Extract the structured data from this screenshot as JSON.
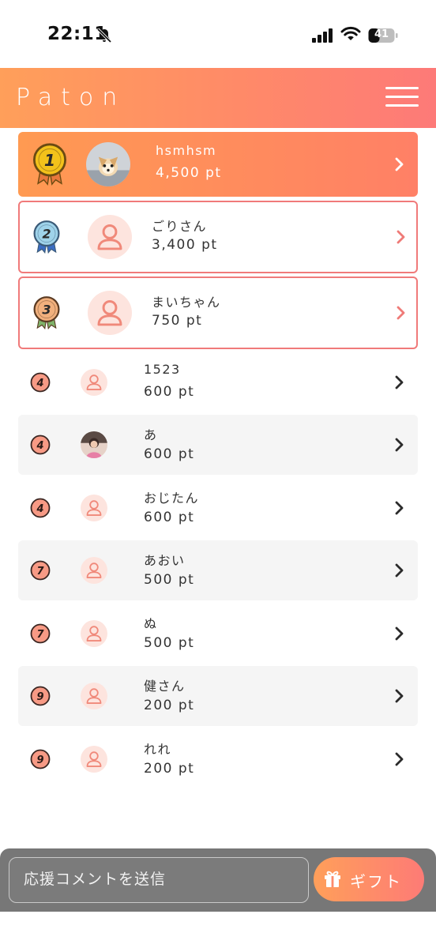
{
  "status_bar": {
    "time": "22:11",
    "battery": "41",
    "icons": [
      "bell-off-icon",
      "signal-icon",
      "wifi-icon",
      "battery-icon"
    ]
  },
  "header": {
    "logo": "Paton",
    "menu_icon": "hamburger-icon"
  },
  "ranking": [
    {
      "rank": "1",
      "name": "hsmhsm",
      "points": "4,500 pt",
      "avatar": "photo-dog"
    },
    {
      "rank": "2",
      "name": "ごりさん",
      "points": "3,400 pt",
      "avatar": "default-user"
    },
    {
      "rank": "3",
      "name": "まいちゃん",
      "points": "750 pt",
      "avatar": "default-user"
    },
    {
      "rank": "4",
      "name": "1523",
      "points": "600 pt",
      "avatar": "default-user"
    },
    {
      "rank": "4",
      "name": "あ",
      "points": "600 pt",
      "avatar": "photo-person"
    },
    {
      "rank": "4",
      "name": "おじたん",
      "points": "600 pt",
      "avatar": "default-user"
    },
    {
      "rank": "7",
      "name": "あおい",
      "points": "500 pt",
      "avatar": "default-user"
    },
    {
      "rank": "7",
      "name": "ぬ",
      "points": "500 pt",
      "avatar": "default-user"
    },
    {
      "rank": "9",
      "name": "健さん",
      "points": "200 pt",
      "avatar": "default-user"
    },
    {
      "rank": "9",
      "name": "れれ",
      "points": "200 pt",
      "avatar": "default-user"
    }
  ],
  "footer": {
    "comment_placeholder": "応援コメントを送信",
    "gift_label": "ギフト",
    "gift_icon": "gift-icon"
  },
  "colors": {
    "accent_start": "#ff9f5a",
    "accent_end": "#fd7a78",
    "avatar_bg": "#fde4de",
    "avatar_fg": "#f0897a"
  }
}
